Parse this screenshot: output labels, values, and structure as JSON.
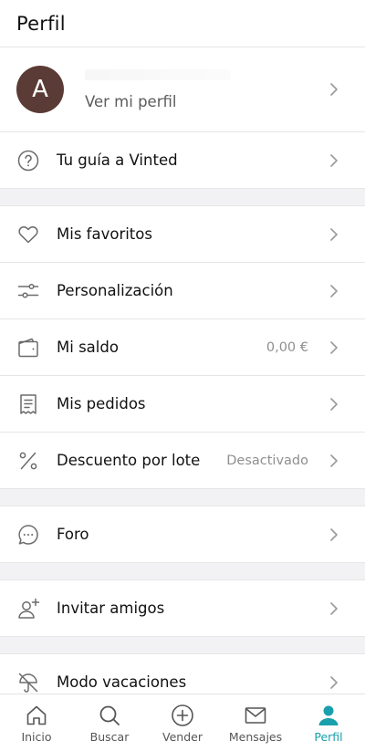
{
  "header": {
    "title": "Perfil"
  },
  "profile": {
    "avatar_letter": "A",
    "link_label": "Ver mi perfil"
  },
  "menu": {
    "guide": {
      "label": "Tu guía a Vinted",
      "icon": "question-circle-icon"
    },
    "favorites": {
      "label": "Mis favoritos",
      "icon": "heart-icon"
    },
    "personalization": {
      "label": "Personalización",
      "icon": "sliders-icon"
    },
    "balance": {
      "label": "Mi saldo",
      "value": "0,00 €",
      "icon": "wallet-icon"
    },
    "orders": {
      "label": "Mis pedidos",
      "icon": "receipt-icon"
    },
    "bundle_discount": {
      "label": "Descuento por lote",
      "value": "Desactivado",
      "icon": "percent-icon"
    },
    "forum": {
      "label": "Foro",
      "icon": "chat-bubble-icon"
    },
    "invite": {
      "label": "Invitar amigos",
      "icon": "add-user-icon"
    },
    "vacation": {
      "label": "Modo vacaciones",
      "icon": "umbrella-off-icon"
    }
  },
  "tabbar": {
    "tabs": [
      {
        "label": "Inicio",
        "icon": "home-icon",
        "active": false
      },
      {
        "label": "Buscar",
        "icon": "search-icon",
        "active": false
      },
      {
        "label": "Vender",
        "icon": "plus-circle-icon",
        "active": false
      },
      {
        "label": "Mensajes",
        "icon": "mail-icon",
        "active": false
      },
      {
        "label": "Perfil",
        "icon": "user-icon",
        "active": true
      }
    ]
  },
  "colors": {
    "accent": "#1aa0ac",
    "avatar_bg": "#5a3b35",
    "section_gap": "#f2f2f4",
    "icon_gray": "#6b6b6b"
  }
}
